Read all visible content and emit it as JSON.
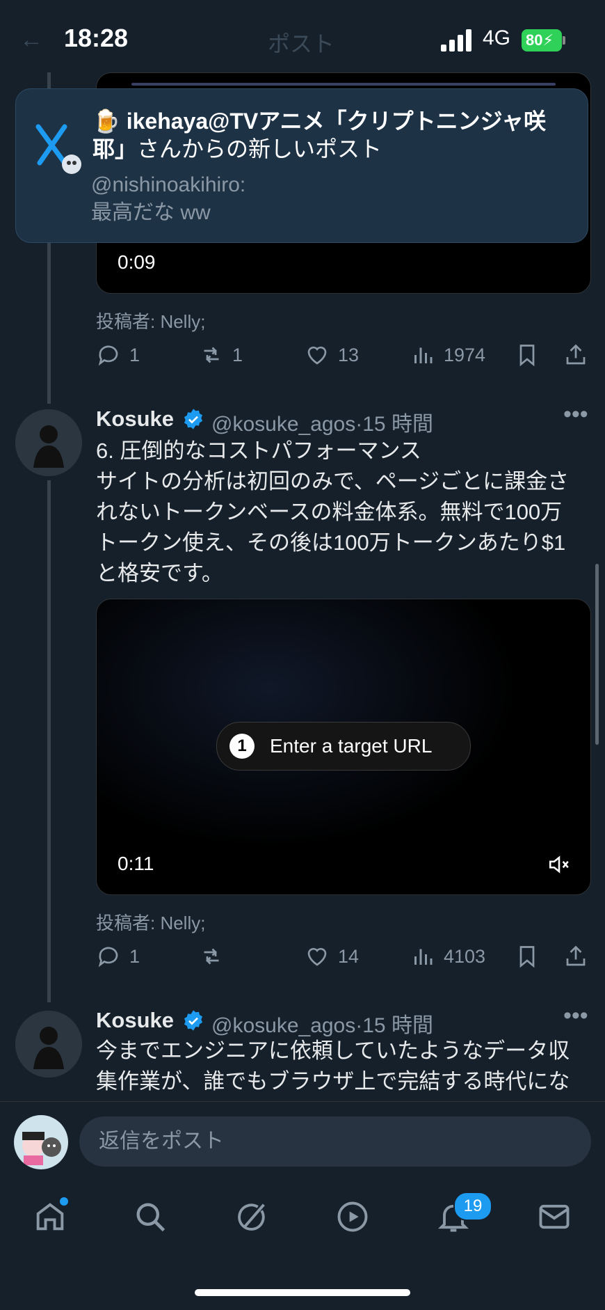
{
  "status_bar": {
    "time": "18:28",
    "network": "4G",
    "battery": "80"
  },
  "ghost_header": {
    "back": "←",
    "title": "ポスト"
  },
  "notification": {
    "emoji": "🍺",
    "title_bold": "ikehaya@TVアニメ「クリプトニンジャ咲耶」",
    "title_rest": "さんからの新しいポスト",
    "sub_handle": "@nishinoakihiro:",
    "sub_text": "最高だな ww"
  },
  "post1": {
    "video_time": "0:09",
    "credit": "投稿者: Nelly;",
    "replies": "1",
    "reposts": "1",
    "likes": "13",
    "views": "1974"
  },
  "post2": {
    "name": "Kosuke",
    "handle": "@kosuke_agos",
    "sep": "·",
    "time_ago": "15 時間",
    "text_lines": [
      "6. 圧倒的なコストパフォーマンス",
      "サイトの分析は初回のみで、ページごとに課金さ",
      "れないトークンベースの料金体系。無料で100万",
      "トークン使え、その後は100万トークンあたり$1",
      "と格安です。"
    ],
    "video_step_number": "1",
    "video_step_label": "Enter a target URL",
    "video_time": "0:11",
    "credit": "投稿者: Nelly;",
    "replies": "1",
    "reposts": "",
    "likes": "14",
    "views": "4103"
  },
  "post3": {
    "name": "Kosuke",
    "handle": "@kosuke_agos",
    "sep": "·",
    "time_ago": "15 時間",
    "text_lines": [
      "今までエンジニアに依頼していたようなデータ収",
      "集作業が、誰でもブラウザ上で完結する時代にな"
    ]
  },
  "reply_bar": {
    "placeholder": "返信をポスト"
  },
  "tabbar": {
    "notification_count": "19"
  },
  "colors": {
    "accent": "#1d9bf0",
    "background": "#15202b",
    "muted": "#8b98a5",
    "battery": "#30d158"
  }
}
